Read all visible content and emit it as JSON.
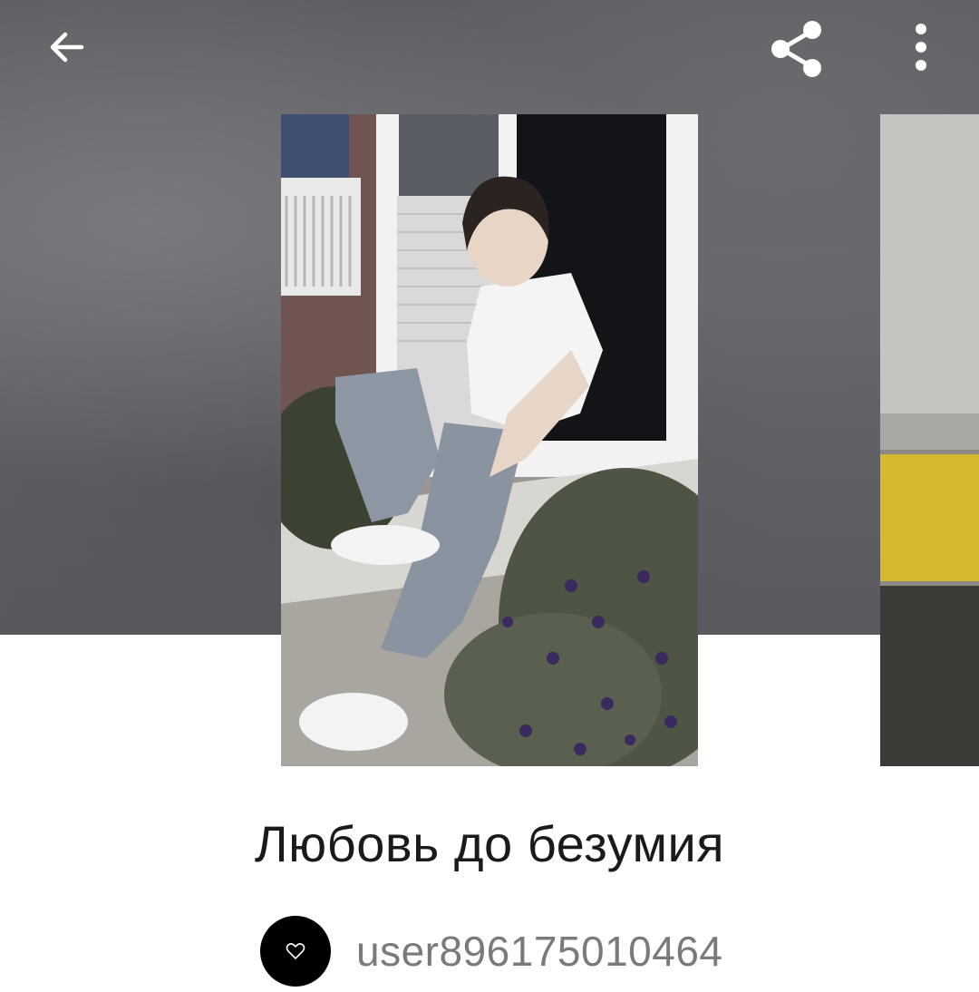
{
  "header": {
    "back_icon": "arrow-left-icon",
    "share_icon": "share-icon",
    "more_icon": "more-vertical-icon"
  },
  "story": {
    "title": "Любовь до безумия",
    "author": "user896175010464",
    "avatar_icon": "heart-outline-icon"
  }
}
